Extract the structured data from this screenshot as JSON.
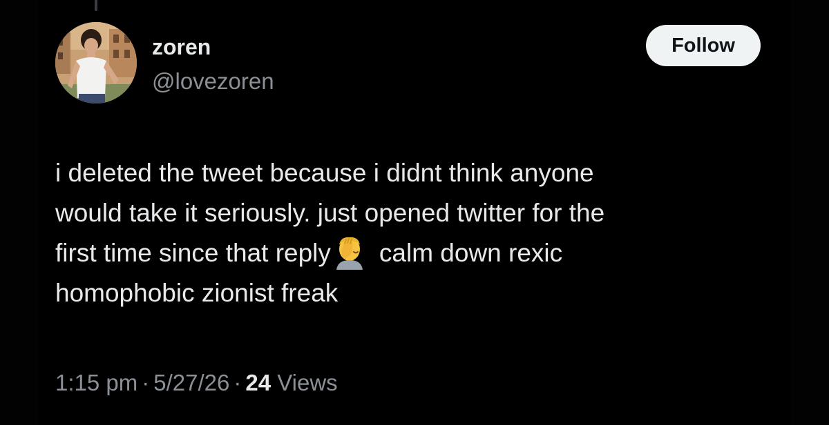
{
  "user": {
    "display_name": "zoren",
    "handle": "@lovezoren",
    "avatar_icon": "profile-photo"
  },
  "actions": {
    "follow_label": "Follow"
  },
  "tweet": {
    "lines": [
      "i deleted the tweet because i didnt think anyone",
      "would take it seriously. just opened twitter for the",
      "first time since that reply",
      "calm down rexic",
      "homophobic zionist freak"
    ],
    "emoji": "facepalm-emoji"
  },
  "meta": {
    "time": "1:15 pm",
    "date": "5/27/26",
    "separator": "·",
    "views_count": "24",
    "views_label": "Views"
  },
  "colors": {
    "background": "#000000",
    "text_primary": "#e7e9ea",
    "text_secondary": "#8b9096",
    "button_bg": "#eff3f4"
  }
}
